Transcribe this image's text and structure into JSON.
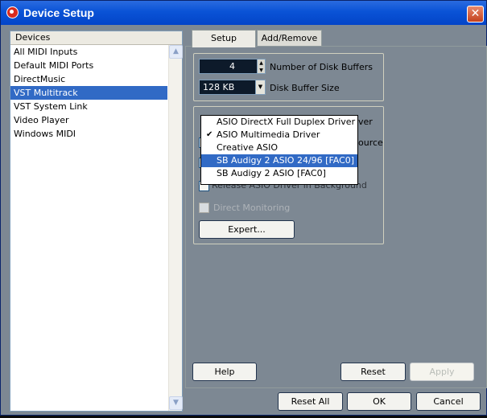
{
  "window": {
    "title": "Device Setup",
    "close_glyph": "✕"
  },
  "devices": {
    "header": "Devices",
    "items": [
      {
        "label": "All MIDI Inputs"
      },
      {
        "label": "Default MIDI Ports"
      },
      {
        "label": "DirectMusic"
      },
      {
        "label": "VST Multitrack"
      },
      {
        "label": "VST System Link"
      },
      {
        "label": "Video Player"
      },
      {
        "label": "Windows MIDI"
      }
    ],
    "selected": "VST Multitrack"
  },
  "tabs": [
    {
      "label": "Setup",
      "active": true
    },
    {
      "label": "Add/Remove",
      "active": false
    }
  ],
  "setup": {
    "disk_buffers_value": "4",
    "disk_buffers_label": "Number of Disk Buffers",
    "disk_buffer_size_value": "128 KB",
    "disk_buffer_size_label": "Disk Buffer Size",
    "direct_monitoring_label": "Direct Monitoring",
    "expert_button": "Expert..."
  },
  "asio_dropdown": {
    "options": [
      {
        "label": "ASIO DirectX Full Duplex Driver",
        "checked": false,
        "highlighted": false
      },
      {
        "label": "ASIO Multimedia Driver",
        "checked": true,
        "highlighted": false
      },
      {
        "label": "Creative ASIO",
        "checked": false,
        "highlighted": false
      },
      {
        "label": "SB Audigy 2 ASIO 24/96 [FAC0]",
        "checked": false,
        "highlighted": true
      },
      {
        "label": "SB Audigy 2 ASIO [FAC0]",
        "checked": false,
        "highlighted": false
      }
    ],
    "peek_right_1": "ver",
    "peek_right_2": "ource",
    "peek_below": "Release ASIO Driver in Background"
  },
  "buttons": {
    "help": "Help",
    "reset": "Reset",
    "apply": "Apply",
    "reset_all": "Reset All",
    "ok": "OK",
    "cancel": "Cancel"
  },
  "colors": {
    "title_bar": "#0a53d6",
    "selection": "#316ac5",
    "panel_bg": "#7d8893"
  }
}
